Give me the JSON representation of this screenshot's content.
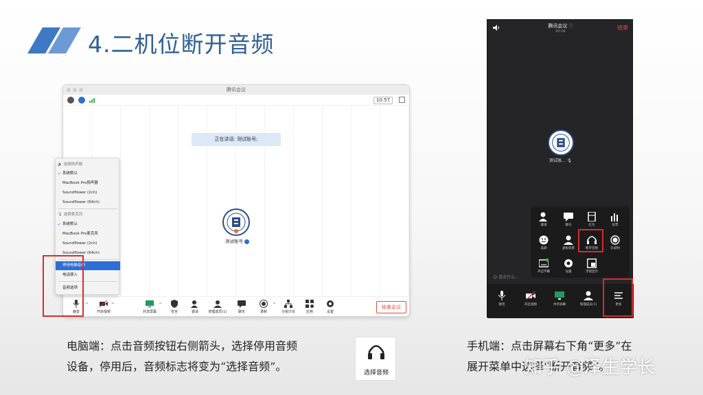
{
  "slide": {
    "title": "4.二机位断开音频"
  },
  "desktop": {
    "window_title": "腾讯会议",
    "time": "10:57",
    "speaking": "正在讲话: 测试账号;",
    "participant_name": "测试账号",
    "toolbar": {
      "mute": "静音",
      "video": "开启视频",
      "share": "共享屏幕",
      "security": "安全",
      "invite": "邀请",
      "members": "管理成员(1)",
      "chat": "聊天",
      "record": "录制",
      "breakout": "分组讨论",
      "apps": "应用",
      "settings": "设置",
      "end": "结束会议"
    },
    "menu": {
      "speaker_header": "选择扬声器",
      "speakers": [
        "系统默认",
        "MacBook Pro扬声器",
        "Soundflower (2ch)",
        "Soundflower (64ch)"
      ],
      "mic_header": "选择麦克风",
      "mics": [
        "系统默认",
        "MacBook Pro麦克风",
        "Soundflower (2ch)",
        "Soundflower (64ch)"
      ],
      "disable_audio": "停用电脑音频",
      "phone_dial": "电话拨入",
      "audio_options": "音频选项"
    }
  },
  "mobile": {
    "title": "腾讯会议",
    "duration": "00:06",
    "end": "结束",
    "participant_name": "测试账...",
    "panel": [
      "邀请",
      "聊天",
      "红包",
      "投票",
      "美颜",
      "虚拟背景",
      "断开音频",
      "云录制",
      "开启字幕",
      "设置",
      "浮窗显示"
    ],
    "input_placeholder": "说点什么...",
    "bar": [
      "静音",
      "开启视频",
      "共享屏幕",
      "管理成员(1)",
      "更多"
    ]
  },
  "captions": {
    "left_line1": "电脑端：点击音频按钮右侧箭头，选择停用音频",
    "left_line2": "设备，停用后，音频标志将变为“选择音频”。",
    "icon_label": "选择音频",
    "right_line1": "手机端：点击屏幕右下角“更多”在",
    "right_line2": "展开菜单中选择“断开音频”。"
  },
  "watermark": "知乎 @泽生学长"
}
